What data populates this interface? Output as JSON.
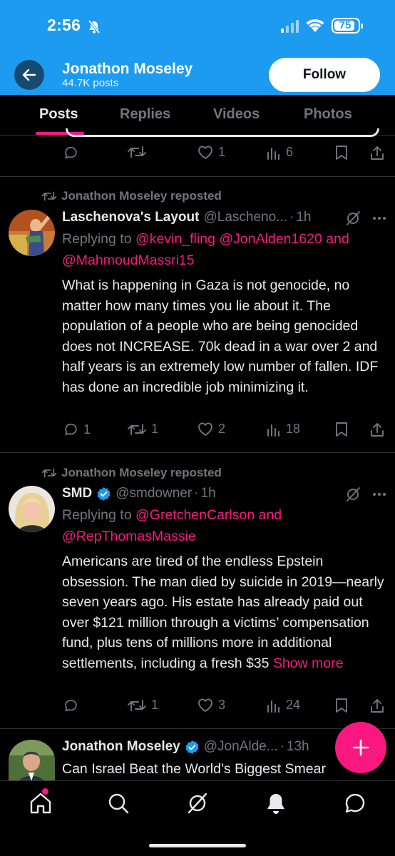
{
  "status_bar": {
    "time": "2:56",
    "battery": "75"
  },
  "header": {
    "name": "Jonathon Moseley",
    "posts": "44.7K posts",
    "follow_label": "Follow"
  },
  "tabs": [
    {
      "label": "Posts",
      "active": true
    },
    {
      "label": "Replies"
    },
    {
      "label": "Videos"
    },
    {
      "label": "Photos"
    }
  ],
  "posts": [
    {
      "actions": {
        "replies": "",
        "reposts": "",
        "likes": "1",
        "views": "6"
      }
    },
    {
      "repost_by": "Jonathon Moseley reposted",
      "author": "Laschenova's Layout",
      "handle": "@Lascheno...",
      "time": "1h",
      "replying_prefix": "Replying to",
      "mentions": [
        "@kevin_fling",
        "@JonAlden1620"
      ],
      "mentions_and": "and",
      "mention_last": "@MahmoudMassri15",
      "text": "What is happening in Gaza is not genocide, no matter how many times you lie about it. The population of a people who are being genocided does not INCREASE. 70k dead in a war over 2 and half years is an extremely low number of fallen. IDF has done an incredible job minimizing it.",
      "actions": {
        "replies": "1",
        "reposts": "1",
        "likes": "2",
        "views": "18"
      }
    },
    {
      "repost_by": "Jonathon Moseley reposted",
      "author": "SMD",
      "handle": "@smdowner",
      "time": "1h",
      "verified": true,
      "replying_prefix": "Replying to",
      "mention_first": "@GretchenCarlson",
      "mentions_and": "and",
      "mention_last": "@RepThomasMassie",
      "text": "Americans are tired of the endless Epstein obsession. The man died by suicide in 2019—nearly seven years ago. His estate has already paid out over $121 million through a victims’ compensation fund, plus tens of millions more in additional settlements, including a fresh $35",
      "show_more": "Show more",
      "actions": {
        "replies": "",
        "reposts": "1",
        "likes": "3",
        "views": "24"
      }
    },
    {
      "author": "Jonathon Moseley",
      "handle": "@JonAlde...",
      "time": "13h",
      "verified": true,
      "text": "Can Israel Beat the World’s Biggest Smear"
    }
  ],
  "icons": {
    "back": "arrow-left-icon",
    "fab": "plus-icon",
    "nav": [
      "home-icon",
      "search-icon",
      "grok-icon",
      "bell-icon",
      "chat-icon"
    ]
  },
  "colors": {
    "header_blue": "#1d9bf0",
    "accent_pink": "#f91880",
    "verified_blue": "#1d9bf0"
  }
}
